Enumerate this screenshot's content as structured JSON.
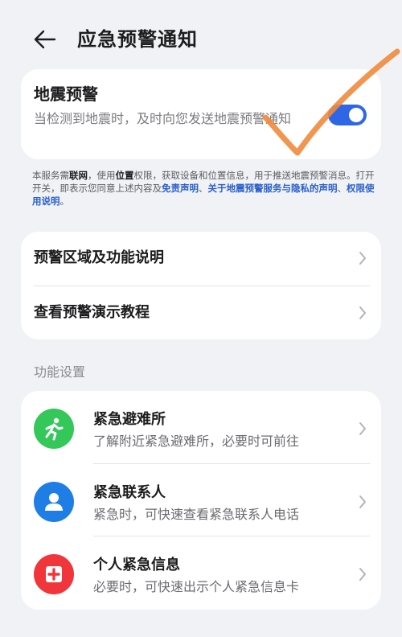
{
  "header": {
    "title": "应急预警通知"
  },
  "earthquake": {
    "title": "地震预警",
    "desc": "当检测到地震时，及时向您发送地震预警通知",
    "toggle_on": true,
    "toggle_color": "#2f66e6"
  },
  "notice": {
    "p1": "本服务需",
    "b1": "联网",
    "p2": "，使用",
    "b2": "位置",
    "p3": "权限，获取设备和位置信息，用于推送地震预警消息。打开开关，即表示您同意上述内容及",
    "link1": "免责声明",
    "sep1": "、",
    "link2": "关于地震预警服务与隐私的声明",
    "sep2": "、",
    "link3": "权限使用说明",
    "end": "。"
  },
  "nav": {
    "items": [
      {
        "label": "预警区域及功能说明"
      },
      {
        "label": "查看预警演示教程"
      }
    ]
  },
  "features": {
    "section_title": "功能设置",
    "items": [
      {
        "title": "紧急避难所",
        "desc": "了解附近紧急避难所，必要时可前往",
        "icon": "running-person-icon",
        "color": "#34c759"
      },
      {
        "title": "紧急联系人",
        "desc": "紧急时，可快速查看紧急联系人电话",
        "icon": "person-icon",
        "color": "#1f7de6"
      },
      {
        "title": "个人紧急信息",
        "desc": "必要时，可快速出示个人紧急信息卡",
        "icon": "medical-cross-icon",
        "color": "#f0353b"
      }
    ]
  },
  "annotation": {
    "color": "#f08a3c"
  }
}
